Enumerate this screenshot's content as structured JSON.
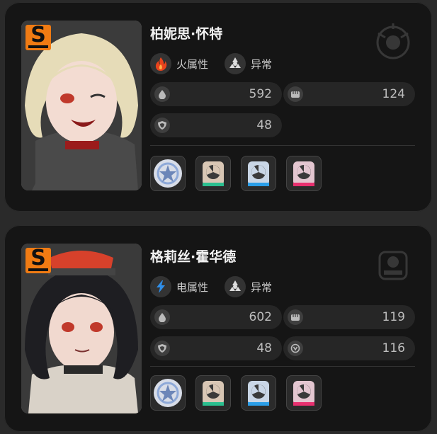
{
  "agents": [
    {
      "rank": "S",
      "name": "柏妮思·怀特",
      "attribute": {
        "label": "火属性",
        "icon": "fire-icon",
        "color": "#e8431c"
      },
      "specialty": {
        "label": "异常",
        "icon": "anomaly-icon"
      },
      "stats": [
        {
          "icon": "hp-drop-icon",
          "value": "592"
        },
        {
          "icon": "attack-fist-icon",
          "value": "124"
        },
        {
          "icon": "defense-shield-icon",
          "value": "48"
        }
      ],
      "equipment": [
        {
          "icon": "w-engine-disc-icon",
          "color": "#8ea9d8"
        },
        {
          "icon": "drive-disc-icon",
          "color": "#2bbf8f"
        },
        {
          "icon": "drive-disc-icon",
          "color": "#2a9ee8"
        },
        {
          "icon": "drive-disc-icon",
          "color": "#e8306f"
        }
      ]
    },
    {
      "rank": "S",
      "name": "格莉丝·霍华德",
      "attribute": {
        "label": "电属性",
        "icon": "lightning-icon",
        "color": "#2f8fea"
      },
      "specialty": {
        "label": "异常",
        "icon": "anomaly-icon"
      },
      "stats": [
        {
          "icon": "hp-drop-icon",
          "value": "602"
        },
        {
          "icon": "attack-fist-icon",
          "value": "119"
        },
        {
          "icon": "defense-shield-icon",
          "value": "48"
        },
        {
          "icon": "anomaly-mastery-icon",
          "value": "116"
        }
      ],
      "equipment": [
        {
          "icon": "w-engine-disc-icon",
          "color": "#8ea9d8"
        },
        {
          "icon": "drive-disc-icon",
          "color": "#2bbf8f"
        },
        {
          "icon": "drive-disc-icon",
          "color": "#2a9ee8"
        },
        {
          "icon": "drive-disc-icon",
          "color": "#e8306f"
        }
      ]
    }
  ]
}
